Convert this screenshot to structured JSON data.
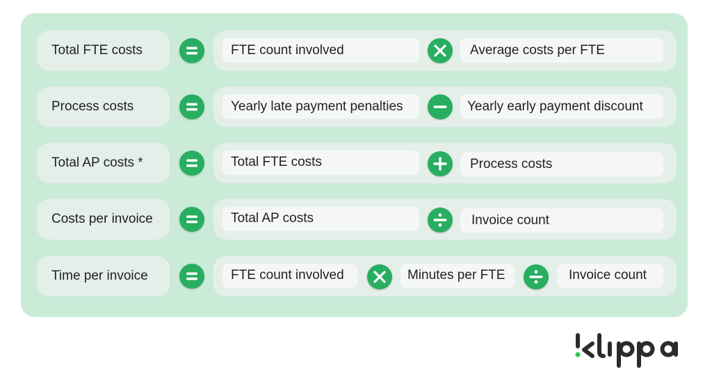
{
  "colors": {
    "panel_bg": "#cbebd9",
    "box_bg": "#e5efea",
    "chip_bg": "#f5f7f6",
    "operator_green": "#27ae60",
    "logo_dark": "#2b2b2b",
    "logo_accent": "#2ecc55"
  },
  "formulas": [
    {
      "result": "Total FTE costs",
      "equals_icon": "equals-icon",
      "terms": [
        "FTE count involved",
        "Average costs per FTE"
      ],
      "operators": [
        "multiply-icon"
      ]
    },
    {
      "result": "Process costs",
      "equals_icon": "equals-icon",
      "terms": [
        "Yearly late payment penalties",
        "Yearly early payment discount"
      ],
      "operators": [
        "minus-icon"
      ]
    },
    {
      "result": "Total AP costs *",
      "equals_icon": "equals-icon",
      "terms": [
        "Total FTE costs",
        "Process costs"
      ],
      "operators": [
        "plus-icon"
      ]
    },
    {
      "result": "Costs per invoice",
      "equals_icon": "equals-icon",
      "terms": [
        "Total AP costs",
        "Invoice count"
      ],
      "operators": [
        "divide-icon"
      ]
    },
    {
      "result": "Time per invoice",
      "equals_icon": "equals-icon",
      "terms": [
        "FTE count involved",
        "Minutes per FTE",
        "Invoice count"
      ],
      "operators": [
        "multiply-icon",
        "divide-icon"
      ]
    }
  ],
  "logo": {
    "text": "klippa"
  }
}
